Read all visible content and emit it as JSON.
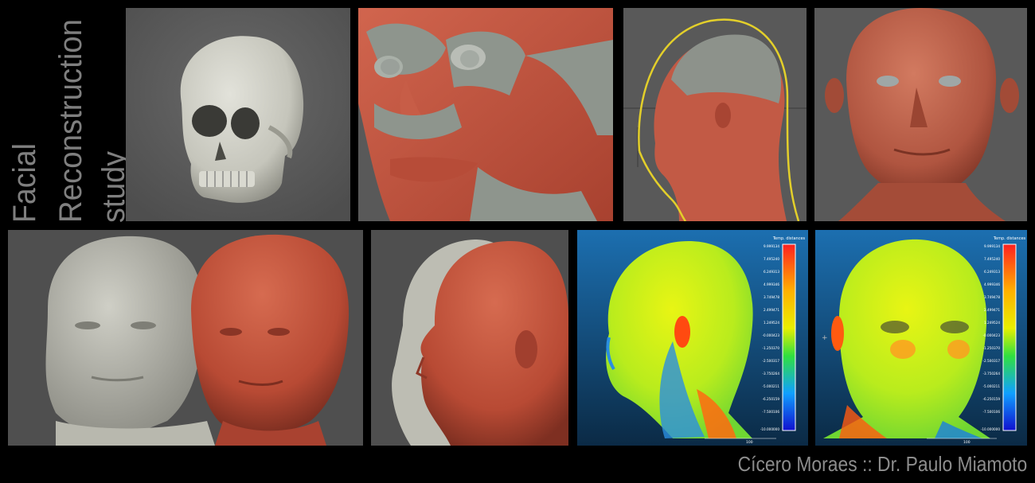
{
  "title": {
    "line1": "Facial",
    "line2": "Reconstruction",
    "line3": "study"
  },
  "credit": "Cícero Moraes :: Dr. Paulo Miamoto",
  "heatmap": {
    "scale_title": "Temp. distances",
    "scale_values": [
      "9.999134",
      "7.495240",
      "6.249313",
      "4.999346",
      "3.749478",
      "2.499471",
      "1.249524",
      "-0.000423",
      "-1.250370",
      "-2.500317",
      "-3.750264",
      "-5.000211",
      "-6.250159",
      "-7.500106",
      "-10.000000"
    ],
    "axis_tick": "100"
  },
  "colors": {
    "background": "#000000",
    "viewport": "#5a5a5a",
    "skull": "#c7c7bd",
    "muscle": "#c4533e",
    "skin": "#b55a45",
    "title_text": "#7f7f7f",
    "credit_text": "#8c8c8c"
  }
}
